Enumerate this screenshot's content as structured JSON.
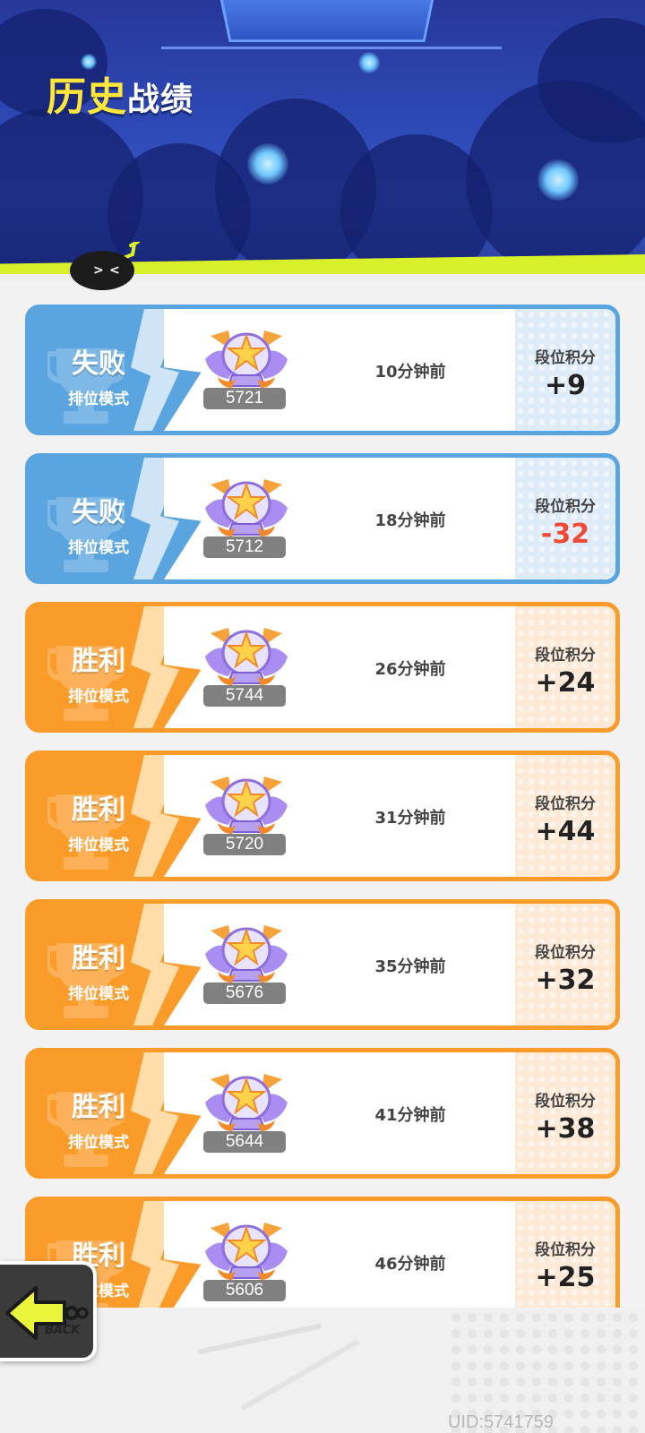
{
  "header": {
    "title_part1": "历史",
    "title_part2": "战绩"
  },
  "matches": [
    {
      "result": "失败",
      "mode": "排位模式",
      "score": "5721",
      "time": "10分钟前",
      "points_label": "段位积分",
      "delta": "+9",
      "type": "lose"
    },
    {
      "result": "失败",
      "mode": "排位模式",
      "score": "5712",
      "time": "18分钟前",
      "points_label": "段位积分",
      "delta": "-32",
      "type": "lose"
    },
    {
      "result": "胜利",
      "mode": "排位模式",
      "score": "5744",
      "time": "26分钟前",
      "points_label": "段位积分",
      "delta": "+24",
      "type": "win"
    },
    {
      "result": "胜利",
      "mode": "排位模式",
      "score": "5720",
      "time": "31分钟前",
      "points_label": "段位积分",
      "delta": "+44",
      "type": "win"
    },
    {
      "result": "胜利",
      "mode": "排位模式",
      "score": "5676",
      "time": "35分钟前",
      "points_label": "段位积分",
      "delta": "+32",
      "type": "win"
    },
    {
      "result": "胜利",
      "mode": "排位模式",
      "score": "5644",
      "time": "41分钟前",
      "points_label": "段位积分",
      "delta": "+38",
      "type": "win"
    },
    {
      "result": "胜利",
      "mode": "排位模式",
      "score": "5606",
      "time": "46分钟前",
      "points_label": "段位积分",
      "delta": "+25",
      "type": "win"
    }
  ],
  "footer": {
    "uid": "UID:5741759",
    "back_label": "BACK"
  },
  "colors": {
    "lose": "#5aa5df",
    "win": "#fb9b2a",
    "negative": "#ee4a34",
    "title_accent": "#ffe63b",
    "band": "#d8f02a"
  },
  "icons": {
    "badge": "rank-badge-icon",
    "trophy": "trophy-icon",
    "back": "back-arrow-icon",
    "mascot": "mascot-icon"
  }
}
